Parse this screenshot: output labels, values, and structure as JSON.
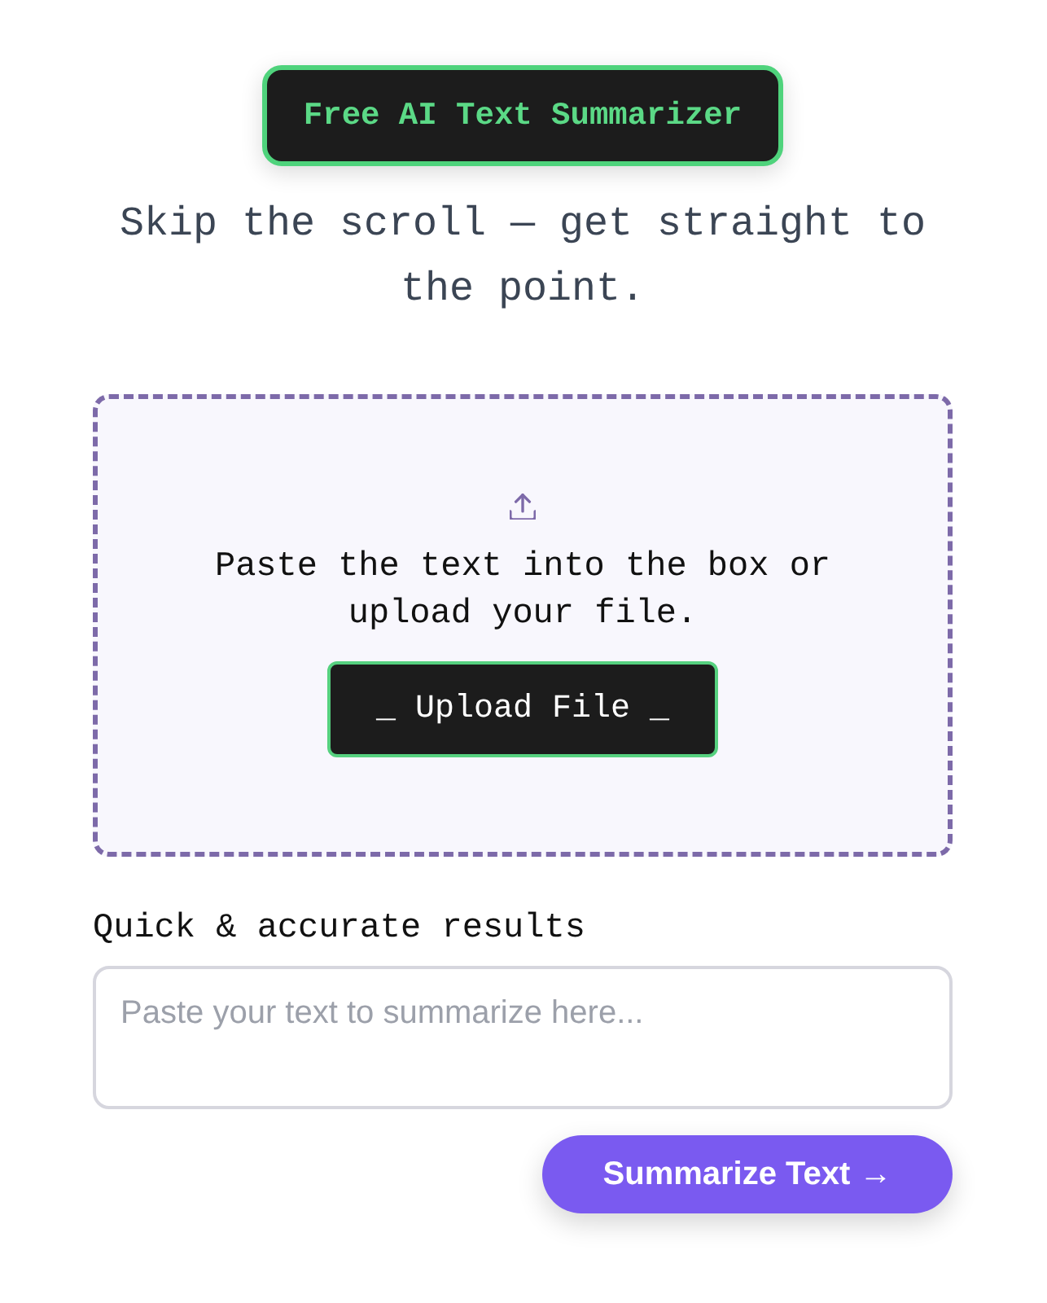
{
  "header": {
    "badge": "Free AI Text Summarizer",
    "tagline": "Skip the scroll — get straight to the point."
  },
  "dropzone": {
    "instruction": "Paste the text into the box or upload your file.",
    "button": "_ Upload File _"
  },
  "input": {
    "label": "Quick & accurate results",
    "placeholder": "Paste your text to summarize here..."
  },
  "submit_button": "Summarize Text →"
}
